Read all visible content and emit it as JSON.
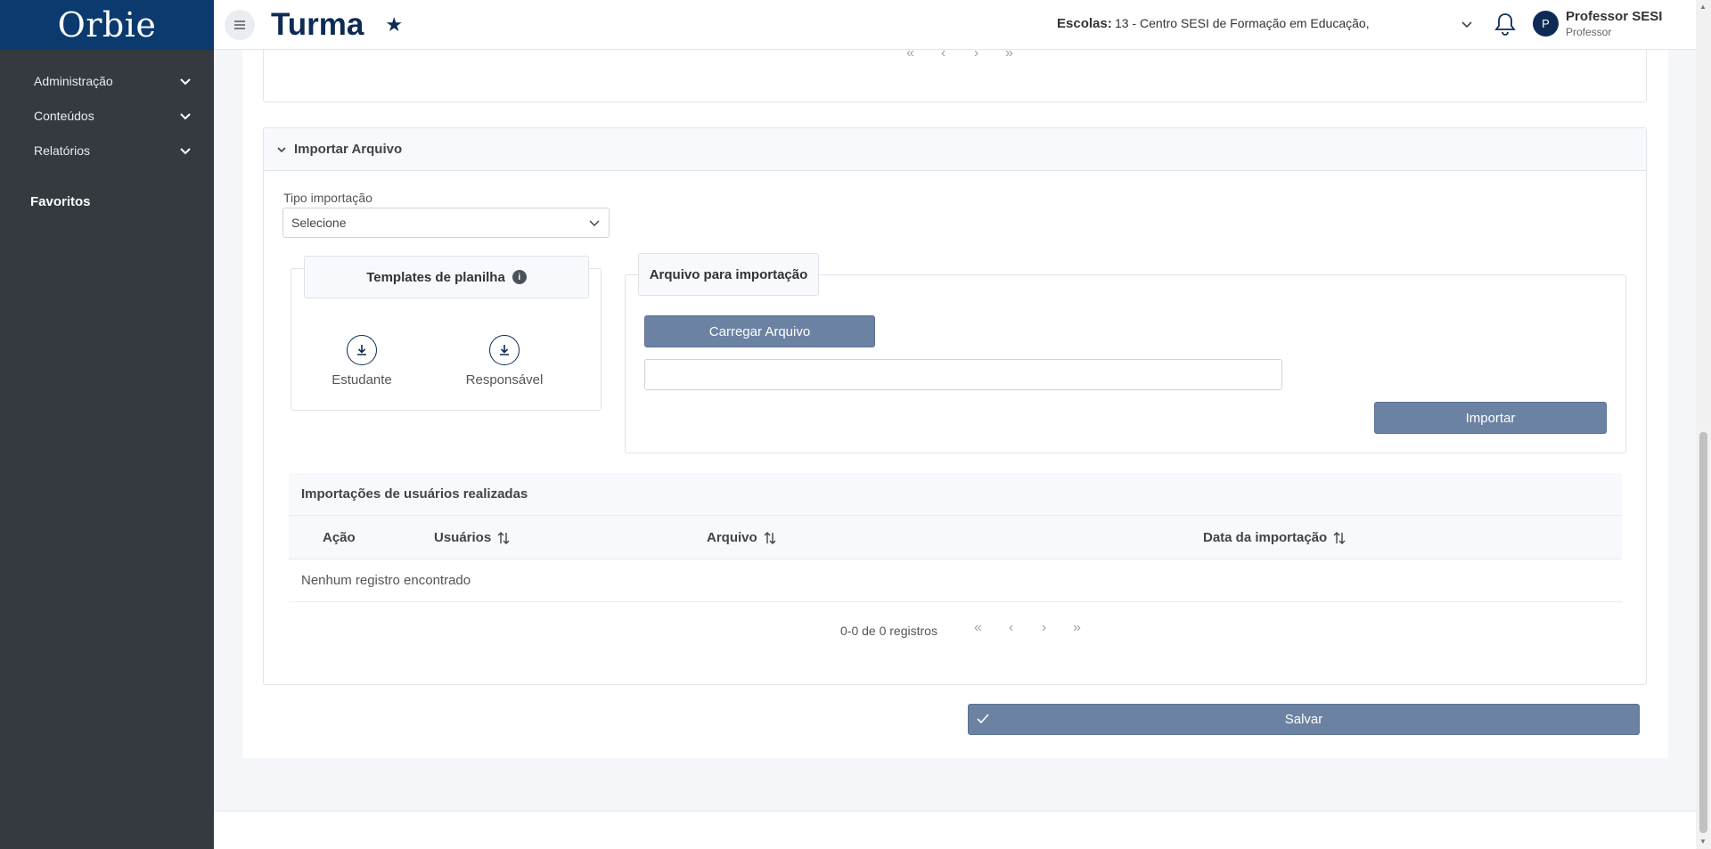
{
  "sidebar": {
    "logo": "Orbie",
    "items": [
      {
        "label": "Administração"
      },
      {
        "label": "Conteúdos"
      },
      {
        "label": "Relatórios"
      }
    ],
    "favorites_label": "Favoritos"
  },
  "header": {
    "title": "Turma",
    "escolas_label": "Escolas:",
    "escolas_value": "13 - Centro SESI de Formação em Educação,",
    "user_initial": "P",
    "user_name": "Professor SESI",
    "user_role": "Professor"
  },
  "import_section": {
    "title": "Importar Arquivo",
    "tipo_label": "Tipo importação",
    "tipo_value": "Selecione",
    "templates_title": "Templates de planilha",
    "templates": [
      {
        "label": "Estudante"
      },
      {
        "label": "Responsável"
      }
    ],
    "arquivo_title": "Arquivo para importação",
    "load_button": "Carregar Arquivo",
    "file_value": "",
    "import_button": "Importar"
  },
  "history": {
    "title": "Importações de usuários realizadas",
    "columns": [
      "Ação",
      "Usuários",
      "Arquivo",
      "Data da importação"
    ],
    "empty_message": "Nenhum registro encontrado",
    "records": "0-0 de 0 registros"
  },
  "pager": {
    "first": "«",
    "prev": "‹",
    "next": "›",
    "last": "»"
  },
  "save_button": "Salvar",
  "colors": {
    "sidebar": "#343a40",
    "brand": "#0b3a6e",
    "button": "#6b82a3",
    "title": "#0d2b55"
  }
}
